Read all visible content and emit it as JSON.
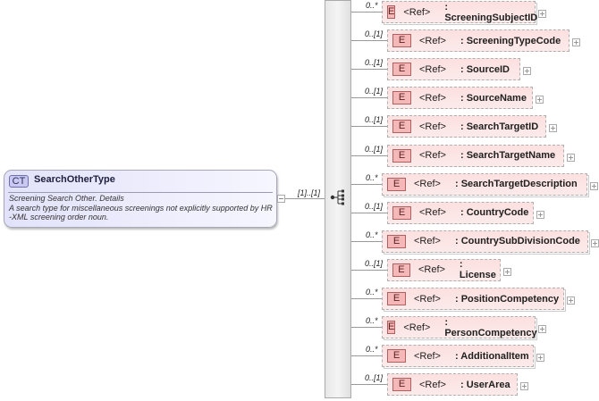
{
  "complex_type": {
    "badge": "CT",
    "name": "SearchOtherType",
    "doc_lines": [
      "Screening Search Other. Details",
      "A search type for miscellaneous screenings not explicitly supported by HR",
      "-XML screening order noun."
    ]
  },
  "sequence": {
    "multiplicity": "[1]..[1]"
  },
  "elements": [
    {
      "mult": "0..*",
      "badge": "E",
      "ref": "<Ref>",
      "name": ": ScreeningSubjectID"
    },
    {
      "mult": "0..[1]",
      "badge": "E",
      "ref": "<Ref>",
      "name": ": ScreeningTypeCode"
    },
    {
      "mult": "0..[1]",
      "badge": "E",
      "ref": "<Ref>",
      "name": ": SourceID"
    },
    {
      "mult": "0..[1]",
      "badge": "E",
      "ref": "<Ref>",
      "name": ": SourceName"
    },
    {
      "mult": "0..[1]",
      "badge": "E",
      "ref": "<Ref>",
      "name": ": SearchTargetID"
    },
    {
      "mult": "0..[1]",
      "badge": "E",
      "ref": "<Ref>",
      "name": ": SearchTargetName"
    },
    {
      "mult": "0..*",
      "badge": "E",
      "ref": "<Ref>",
      "name": ": SearchTargetDescription"
    },
    {
      "mult": "0..[1]",
      "badge": "E",
      "ref": "<Ref>",
      "name": ": CountryCode"
    },
    {
      "mult": "0..*",
      "badge": "E",
      "ref": "<Ref>",
      "name": ": CountrySubDivisionCode"
    },
    {
      "mult": "0..[1]",
      "badge": "E",
      "ref": "<Ref>",
      "name": ": License"
    },
    {
      "mult": "0..*",
      "badge": "E",
      "ref": "<Ref>",
      "name": ": PositionCompetency"
    },
    {
      "mult": "0..*",
      "badge": "E",
      "ref": "<Ref>",
      "name": ": PersonCompetency"
    },
    {
      "mult": "0..*",
      "badge": "E",
      "ref": "<Ref>",
      "name": ": AdditionalItem"
    },
    {
      "mult": "0..[1]",
      "badge": "E",
      "ref": "<Ref>",
      "name": ": UserArea"
    }
  ]
}
